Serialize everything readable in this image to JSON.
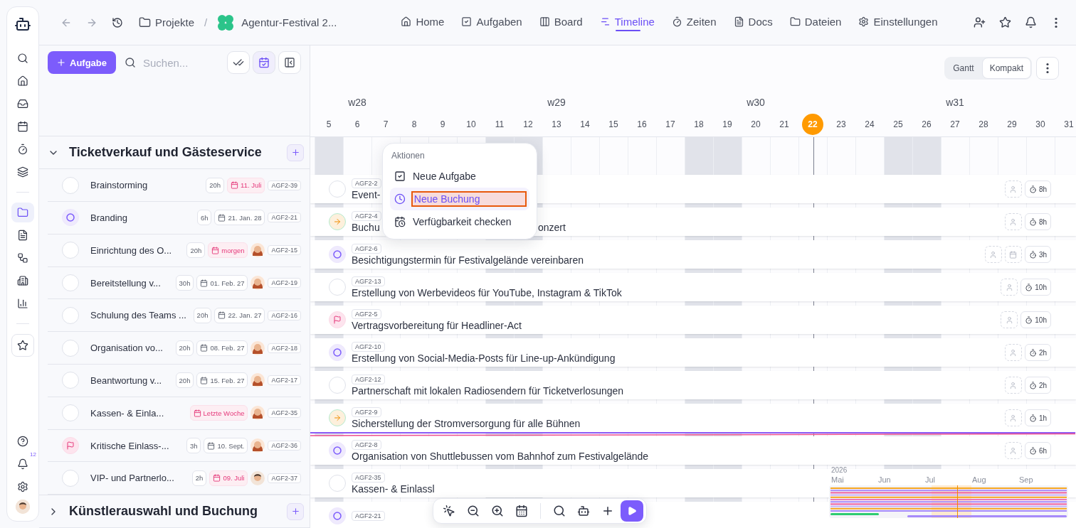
{
  "rail": {
    "top": [
      {
        "kind": "search",
        "selected": false
      },
      {
        "kind": "home",
        "selected": false
      },
      {
        "kind": "inbox",
        "selected": false
      },
      {
        "kind": "calendar",
        "selected": false
      },
      {
        "kind": "timer",
        "selected": false
      },
      {
        "kind": "layers",
        "selected": false
      }
    ],
    "middle": [
      {
        "kind": "folder",
        "selected": true
      },
      {
        "kind": "file",
        "selected": false
      },
      {
        "kind": "workflow",
        "selected": false
      },
      {
        "kind": "building",
        "selected": false
      },
      {
        "kind": "chart",
        "selected": false
      }
    ],
    "favorite": {
      "kind": "star",
      "selected": false
    },
    "bottom": [
      {
        "kind": "help",
        "selected": false
      },
      {
        "kind": "bell",
        "selected": false,
        "badge": "12"
      },
      {
        "kind": "settings",
        "selected": false
      },
      {
        "kind": "avatar",
        "selected": false
      }
    ]
  },
  "breadcrumbs": {
    "root": "Projekte",
    "separator": "/",
    "project": "Agentur-Festival 2..."
  },
  "nav_tabs": [
    {
      "kind": "home",
      "label": "Home",
      "selected": false
    },
    {
      "kind": "tasks",
      "label": "Aufgaben",
      "selected": false
    },
    {
      "kind": "board",
      "label": "Board",
      "selected": false
    },
    {
      "kind": "timeline",
      "label": "Timeline",
      "selected": true
    },
    {
      "kind": "timer",
      "label": "Zeiten",
      "selected": false
    },
    {
      "kind": "docs",
      "label": "Docs",
      "selected": false
    },
    {
      "kind": "files",
      "label": "Dateien",
      "selected": false
    },
    {
      "kind": "settings",
      "label": "Einstellungen",
      "selected": false
    }
  ],
  "header_actions": [
    {
      "kind": "invite"
    },
    {
      "kind": "star"
    },
    {
      "kind": "bell"
    },
    {
      "kind": "more"
    }
  ],
  "task_panel": {
    "add_button": "Aufgabe",
    "search": {
      "placeholder": "Suchen..."
    },
    "view_buttons": [
      {
        "kind": "check-all"
      },
      {
        "kind": "calendar",
        "on": true
      },
      {
        "kind": "panel"
      }
    ],
    "groups": [
      {
        "title": "Ticketverkauf und Gästeservice",
        "expanded": true,
        "tasks": [
          {
            "kind": "open",
            "title": "Brainstorming",
            "hours": "20h",
            "date": {
              "text": "11. Juli",
              "overdue": true
            },
            "id": "AGF2-39"
          },
          {
            "kind": "progress",
            "title": "Branding",
            "hours": "6h",
            "date": {
              "text": "21. Jan. 28",
              "overdue": false
            },
            "id": "AGF2-21"
          },
          {
            "kind": "open",
            "title": "Einrichtung des O...",
            "hours": "20h",
            "date": {
              "text": "morgen",
              "overdue": true
            },
            "avatar": {
              "kind": "long-hair"
            },
            "id": "AGF2-15"
          },
          {
            "kind": "open",
            "title": "Bereitstellung v...",
            "hours": "30h",
            "date": {
              "text": "01. Feb. 27",
              "overdue": false
            },
            "avatar": {
              "kind": "long-hair"
            },
            "id": "AGF2-19"
          },
          {
            "kind": "open",
            "title": "Schulung des Teams ...",
            "hours": "20h",
            "date": {
              "text": "22. Jan. 27",
              "overdue": false
            },
            "id": "AGF2-16"
          },
          {
            "kind": "open",
            "title": "Organisation vo...",
            "hours": "20h",
            "date": {
              "text": "08. Feb. 27",
              "overdue": false
            },
            "avatar": {
              "kind": "long-hair"
            },
            "id": "AGF2-18"
          },
          {
            "kind": "open",
            "title": "Beantwortung v...",
            "hours": "20h",
            "date": {
              "text": "15. Feb. 27",
              "overdue": false
            },
            "avatar": {
              "kind": "long-hair"
            },
            "id": "AGF2-17"
          },
          {
            "kind": "open",
            "title": "Kassen- & Einla...",
            "date": {
              "text": "Letzte Woche",
              "overdue": true
            },
            "avatar": {
              "kind": "long-hair"
            },
            "id": "AGF2-35"
          },
          {
            "kind": "flag",
            "title": "Kritische Einlass-...",
            "hours": "3h",
            "date": {
              "text": "10. Sept.",
              "overdue": false
            },
            "avatar": {
              "kind": "long-hair"
            },
            "id": "AGF2-36"
          },
          {
            "kind": "open",
            "title": "VIP- und Partnerlo...",
            "hours": "2h",
            "date": {
              "text": "09. Juli",
              "overdue": true
            },
            "avatar": {
              "kind": "short-hair"
            },
            "id": "AGF2-37"
          }
        ]
      },
      {
        "title": "Künstlerauswahl und Buchung",
        "expanded": false
      }
    ]
  },
  "timeline": {
    "view_toggle": [
      {
        "label": "Gantt",
        "selected": false
      },
      {
        "label": "Kompakt",
        "selected": true
      }
    ],
    "days": [
      {
        "label": "5",
        "weekend": true,
        "today": false
      },
      {
        "label": "6",
        "week": "w28",
        "weekend": false,
        "today": false
      },
      {
        "label": "7",
        "weekend": false,
        "today": false
      },
      {
        "label": "8",
        "weekend": false,
        "today": false
      },
      {
        "label": "9",
        "weekend": false,
        "today": false
      },
      {
        "label": "10",
        "weekend": false,
        "today": false
      },
      {
        "label": "11",
        "weekend": true,
        "today": false
      },
      {
        "label": "12",
        "weekend": true,
        "today": false
      },
      {
        "label": "13",
        "week": "w29",
        "weekend": false,
        "today": false
      },
      {
        "label": "14",
        "weekend": false,
        "today": false
      },
      {
        "label": "15",
        "weekend": false,
        "today": false
      },
      {
        "label": "16",
        "weekend": false,
        "today": false
      },
      {
        "label": "17",
        "weekend": false,
        "today": false
      },
      {
        "label": "18",
        "weekend": true,
        "today": false
      },
      {
        "label": "19",
        "weekend": true,
        "today": false
      },
      {
        "label": "20",
        "week": "w30",
        "weekend": false,
        "today": false
      },
      {
        "label": "21",
        "weekend": false,
        "today": false
      },
      {
        "label": "22",
        "weekend": false,
        "today": true
      },
      {
        "label": "23",
        "weekend": false,
        "today": false
      },
      {
        "label": "24",
        "weekend": false,
        "today": false
      },
      {
        "label": "25",
        "weekend": true,
        "today": false
      },
      {
        "label": "26",
        "weekend": true,
        "today": false
      },
      {
        "label": "27",
        "week": "w31",
        "weekend": false,
        "today": false
      },
      {
        "label": "28",
        "weekend": false,
        "today": false
      },
      {
        "label": "29",
        "weekend": false,
        "today": false
      },
      {
        "label": "30",
        "weekend": false,
        "today": false
      },
      {
        "label": "31",
        "weekend": false,
        "today": false
      }
    ],
    "rows": [
      {
        "kind": "open",
        "id": "AGF2-2",
        "title": "Event-",
        "chips": [
          {
            "kind": "assignee"
          },
          {
            "kind": "hours",
            "text": "8h"
          }
        ]
      },
      {
        "kind": "arrow",
        "id": "AGF2-4",
        "title": "Buchu",
        "title_tail": "onzert",
        "chips": [
          {
            "kind": "assignee"
          },
          {
            "kind": "hours",
            "text": "8h"
          }
        ]
      },
      {
        "kind": "progress",
        "id": "AGF2-6",
        "title": "Besichtigungstermin für Festivalgelände vereinbaren",
        "chips": [
          {
            "kind": "assignee"
          },
          {
            "kind": "calendar"
          },
          {
            "kind": "hours",
            "text": "3h"
          }
        ]
      },
      {
        "kind": "open",
        "id": "AGF2-13",
        "title": "Erstellung von Werbevideos für YouTube, Instagram & TikTok",
        "chips": [
          {
            "kind": "assignee"
          },
          {
            "kind": "hours",
            "text": "10h"
          }
        ]
      },
      {
        "kind": "flag",
        "id": "AGF2-5",
        "title": "Vertragsvorbereitung für Headliner-Act",
        "chips": [
          {
            "kind": "assignee"
          },
          {
            "kind": "hours",
            "text": "10h"
          }
        ]
      },
      {
        "kind": "progress",
        "id": "AGF2-10",
        "title": "Erstellung von Social-Media-Posts für Line-up-Ankündigung",
        "chips": [
          {
            "kind": "assignee"
          },
          {
            "kind": "hours",
            "text": "2h"
          }
        ]
      },
      {
        "kind": "open",
        "id": "AGF2-12",
        "title": "Partnerschaft mit lokalen Radiosendern für Ticketverlosungen",
        "chips": [
          {
            "kind": "assignee"
          },
          {
            "kind": "hours",
            "text": "2h"
          }
        ]
      },
      {
        "kind": "arrow",
        "id": "AGF2-9",
        "title": "Sicherstellung der Stromversorgung für alle Bühnen",
        "chips": [
          {
            "kind": "assignee"
          },
          {
            "kind": "hours",
            "text": "1h"
          }
        ]
      },
      {
        "kind": "progress",
        "id": "AGF2-8",
        "title": "Organisation von Shuttlebussen vom Bahnhof zum Festivalgelände",
        "chips": [
          {
            "kind": "assignee"
          },
          {
            "kind": "hours",
            "text": "6h"
          }
        ]
      },
      {
        "kind": "open",
        "id": "AGF2-35",
        "title": "Kassen- & Einlassl"
      },
      {
        "kind": "progress",
        "id": "AGF2-21"
      }
    ],
    "menu": {
      "title": "Aktionen",
      "items": [
        {
          "kind": "task",
          "label": "Neue Aufgabe",
          "selected": false
        },
        {
          "kind": "booking",
          "label": "Neue Buchung",
          "selected": true
        },
        {
          "kind": "availability",
          "label": "Verfügbarkeit checken",
          "selected": false
        }
      ]
    },
    "tools": [
      {
        "kind": "pointer"
      },
      {
        "kind": "zoom-out"
      },
      {
        "kind": "zoom-in"
      },
      {
        "kind": "calendar"
      },
      {
        "kind": "divider"
      },
      {
        "kind": "search"
      },
      {
        "kind": "bot"
      },
      {
        "kind": "add"
      },
      {
        "kind": "play"
      }
    ],
    "minimap": {
      "year": "2026",
      "months": [
        "Mai",
        "Jun",
        "Jul",
        "Aug",
        "Sep"
      ]
    }
  }
}
